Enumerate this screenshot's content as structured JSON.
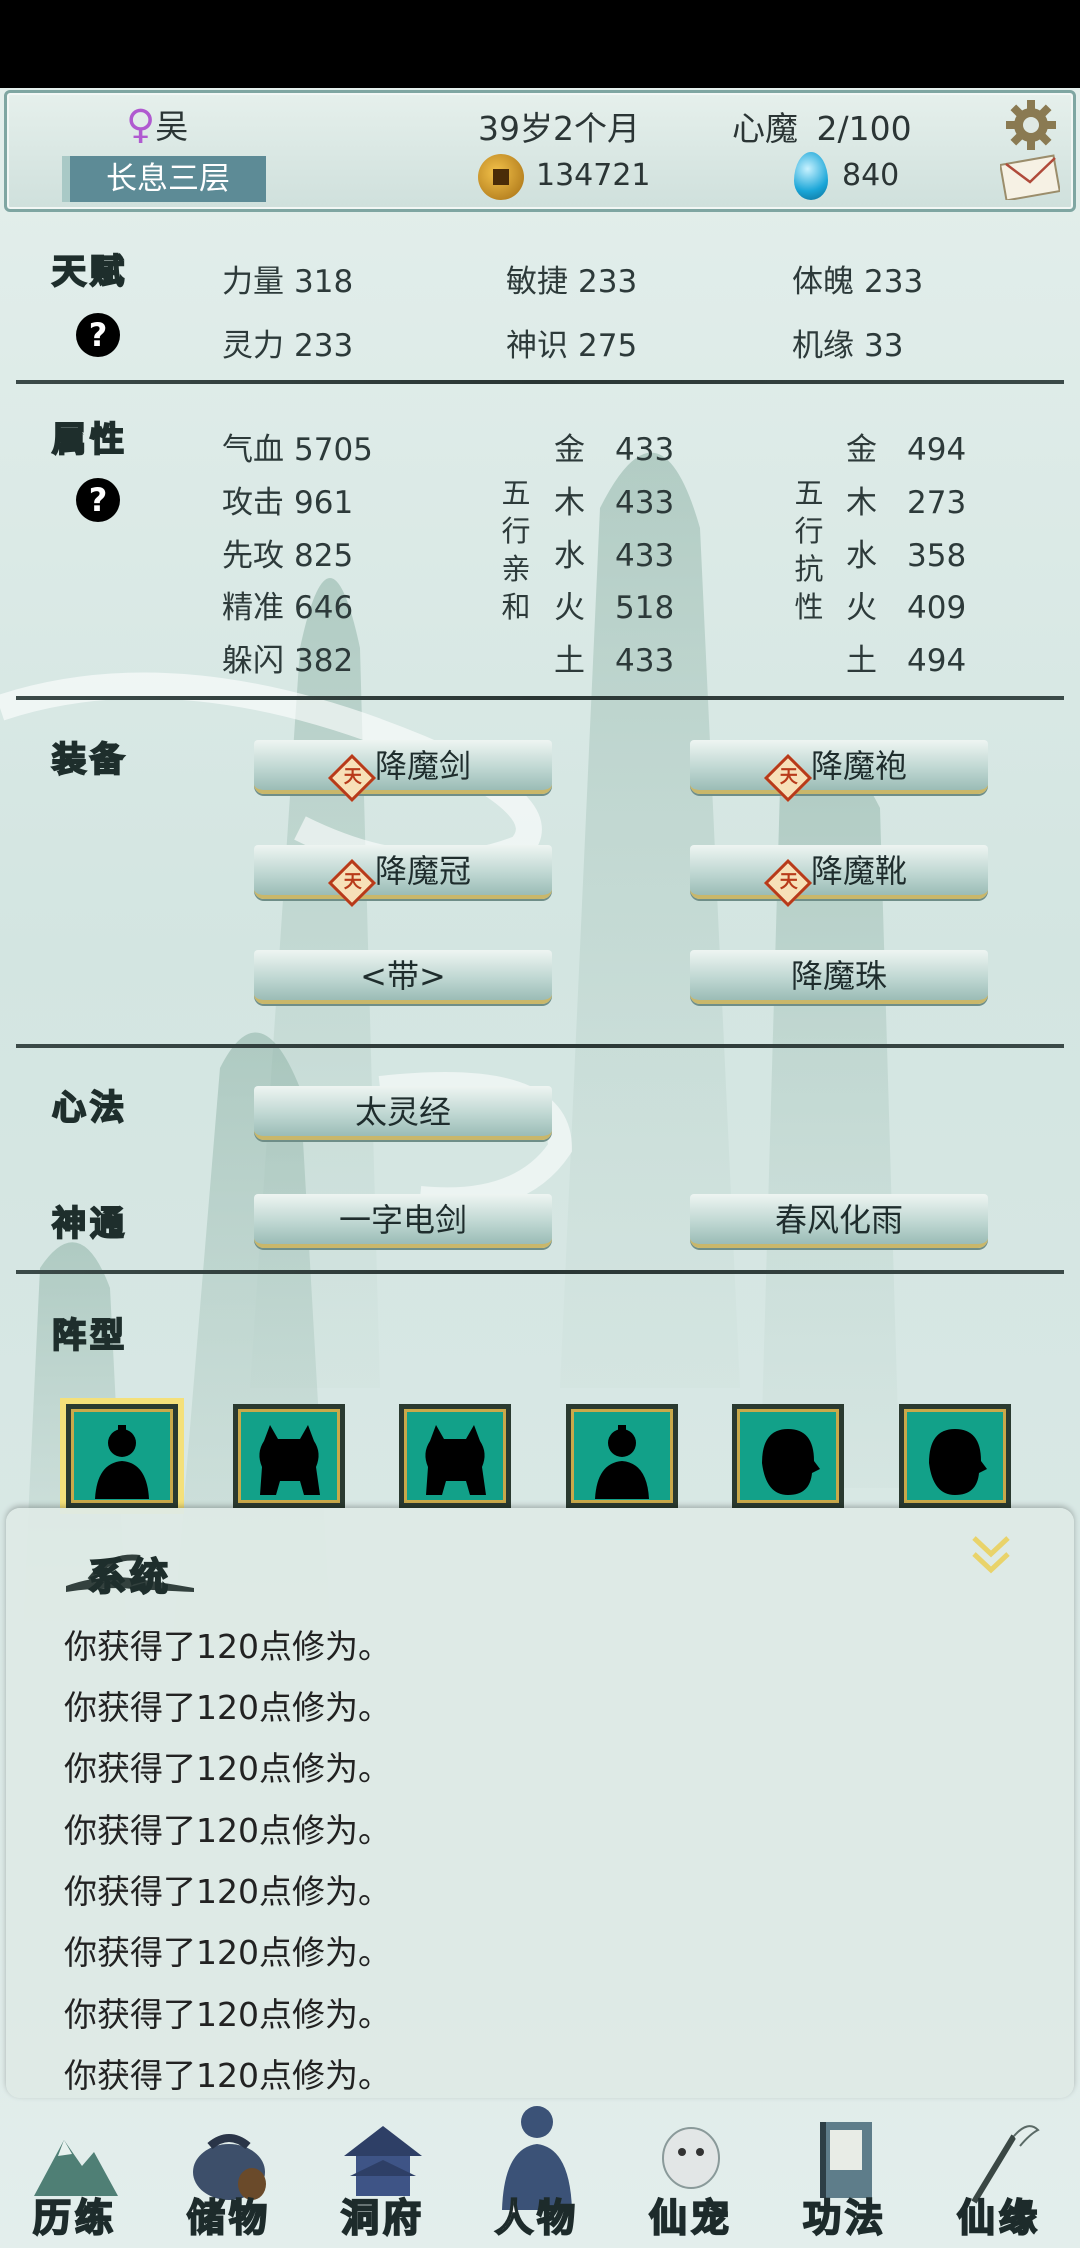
{
  "header": {
    "gender_symbol": "♀",
    "name": "吴",
    "realm": "长息三层",
    "age": "39岁2个月",
    "inner_demon_label": "心魔",
    "inner_demon_value": "2/100",
    "coins": "134721",
    "spirit_stones": "840"
  },
  "talent": {
    "label": "天赋",
    "help": "?",
    "stats": [
      {
        "name": "力量",
        "value": "318"
      },
      {
        "name": "敏捷",
        "value": "233"
      },
      {
        "name": "体魄",
        "value": "233"
      },
      {
        "name": "灵力",
        "value": "233"
      },
      {
        "name": "神识",
        "value": "275"
      },
      {
        "name": "机缘",
        "value": "33"
      }
    ]
  },
  "attributes": {
    "label": "属性",
    "help": "?",
    "stats": [
      {
        "name": "气血",
        "value": "5705"
      },
      {
        "name": "攻击",
        "value": "961"
      },
      {
        "name": "先攻",
        "value": "825"
      },
      {
        "name": "精准",
        "value": "646"
      },
      {
        "name": "躲闪",
        "value": "382"
      }
    ],
    "affinity_label": [
      "五",
      "行",
      "亲",
      "和"
    ],
    "affinity": [
      {
        "element": "金",
        "value": "433"
      },
      {
        "element": "木",
        "value": "433"
      },
      {
        "element": "水",
        "value": "433"
      },
      {
        "element": "火",
        "value": "518"
      },
      {
        "element": "土",
        "value": "433"
      }
    ],
    "resist_label": [
      "五",
      "行",
      "抗",
      "性"
    ],
    "resist": [
      {
        "element": "金",
        "value": "494"
      },
      {
        "element": "木",
        "value": "273"
      },
      {
        "element": "水",
        "value": "358"
      },
      {
        "element": "火",
        "value": "409"
      },
      {
        "element": "土",
        "value": "494"
      }
    ]
  },
  "equipment": {
    "label": "装备",
    "tier_mark": "天",
    "items": [
      {
        "name": "降魔剑",
        "tier": true
      },
      {
        "name": "降魔袍",
        "tier": true
      },
      {
        "name": "降魔冠",
        "tier": true
      },
      {
        "name": "降魔靴",
        "tier": true
      },
      {
        "name": "<带>",
        "tier": false
      },
      {
        "name": "降魔珠",
        "tier": false
      }
    ]
  },
  "mind_method": {
    "label": "心法",
    "items": [
      "太灵经"
    ]
  },
  "divine_power": {
    "label": "神通",
    "items": [
      "一字电剑",
      "春风化雨"
    ]
  },
  "formation": {
    "label": "阵型",
    "slots": [
      "human",
      "beast",
      "beast",
      "human",
      "ghost",
      "ghost"
    ],
    "selected_index": 0
  },
  "system": {
    "title": "系统",
    "messages": [
      "你获得了120点修为。",
      "你获得了120点修为。",
      "你获得了120点修为。",
      "你获得了120点修为。",
      "你获得了120点修为。",
      "你获得了120点修为。",
      "你获得了120点修为。",
      "你获得了120点修为。"
    ]
  },
  "nav": {
    "items": [
      "历练",
      "储物",
      "洞府",
      "人物",
      "仙宠",
      "功法",
      "仙缘"
    ],
    "active_index": 3
  },
  "colors": {
    "accent_teal": "#12a189",
    "realm_bg": "#5d8b96",
    "gender": "#b05ad0"
  }
}
